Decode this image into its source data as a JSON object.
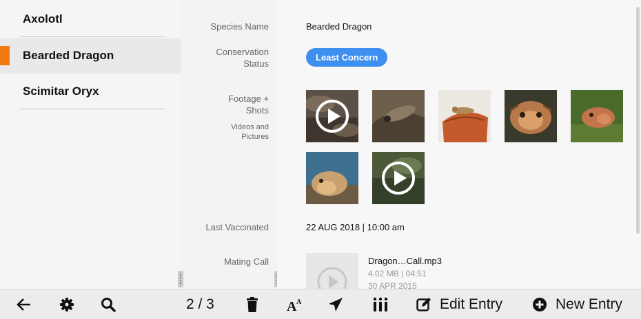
{
  "sidebar": {
    "items": [
      {
        "label": "Axolotl"
      },
      {
        "label": "Bearded Dragon"
      },
      {
        "label": "Scimitar Oryx"
      }
    ]
  },
  "labels": {
    "species_name": "Species Name",
    "conservation_line1": "Conservation",
    "conservation_line2": "Status",
    "footage_line1": "Footage +",
    "footage_line2": "Shots",
    "footage_sub1": "Videos and",
    "footage_sub2": "Pictures",
    "last_vaccinated": "Last Vaccinated",
    "mating_call": "Mating Call"
  },
  "record": {
    "species_name": "Bearded Dragon",
    "conservation_status": "Least Concern",
    "last_vaccinated": "22 AUG 2018  |  10:00 am",
    "audio": {
      "filename": "Dragon…Call.mp3",
      "meta": "4.02 MB  |  04:51",
      "date": "30 APR 2015"
    }
  },
  "media": [
    {
      "kind": "video",
      "icon": "play-icon"
    },
    {
      "kind": "photo"
    },
    {
      "kind": "photo"
    },
    {
      "kind": "photo"
    },
    {
      "kind": "photo"
    },
    {
      "kind": "photo"
    },
    {
      "kind": "video",
      "icon": "play-icon"
    }
  ],
  "toolbar": {
    "pager": "2 / 3",
    "edit_label": "Edit Entry",
    "new_label": "New Entry",
    "icons": [
      "back-arrow-icon",
      "gear-icon",
      "search-icon",
      "trash-icon",
      "font-size-icon",
      "send-icon",
      "columns-icon",
      "edit-icon",
      "plus-circle-icon"
    ]
  },
  "colors": {
    "accent": "#f2790f",
    "badge": "#3d8ff0"
  }
}
